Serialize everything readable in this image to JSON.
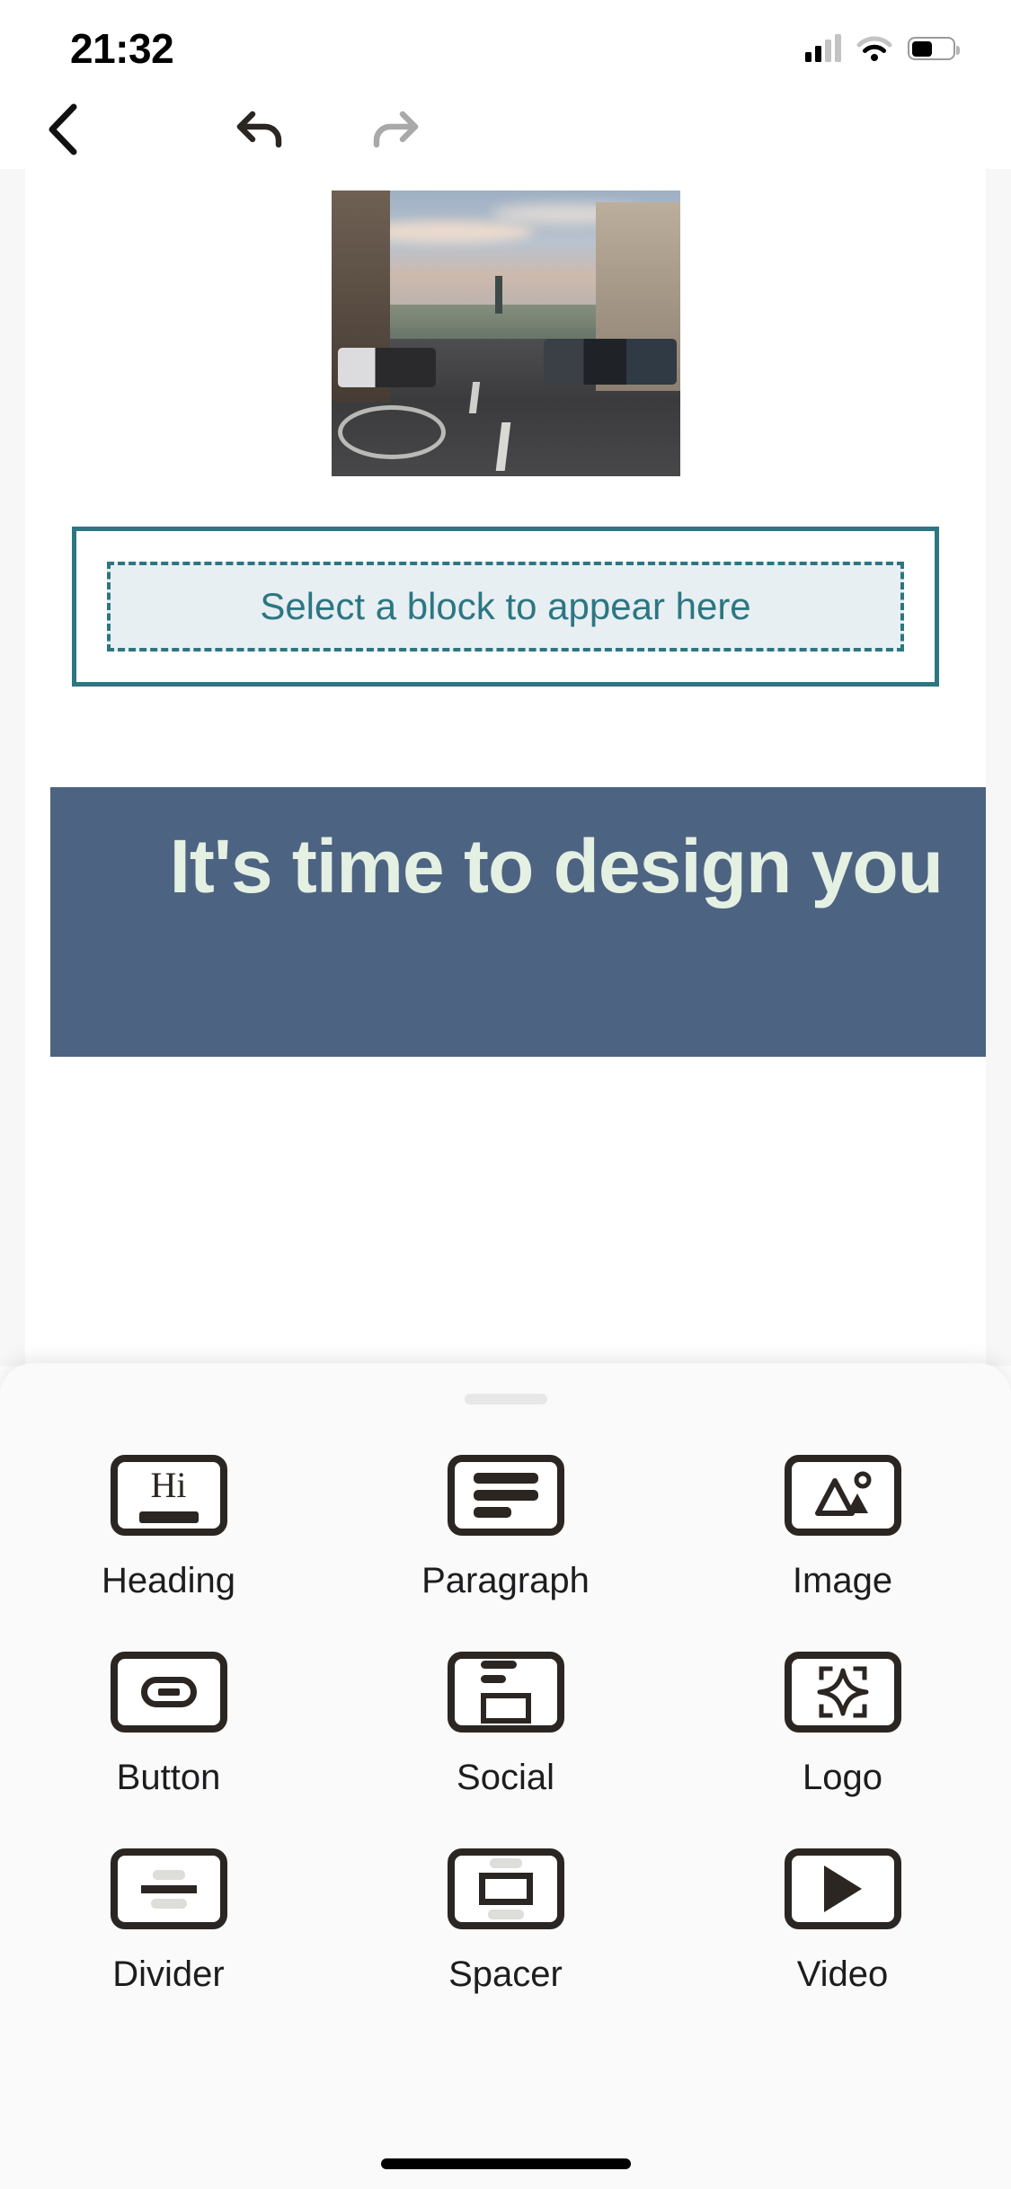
{
  "status_bar": {
    "time": "21:32",
    "cellular_icon": "cellular-signal-icon",
    "wifi_icon": "wifi-icon",
    "battery_icon": "battery-icon",
    "battery_level_percent": 52
  },
  "toolbar": {
    "back_icon": "chevron-left-icon",
    "undo_icon": "undo-arrow-icon",
    "redo_icon": "redo-arrow-icon",
    "undo_enabled": true,
    "redo_enabled": false
  },
  "canvas": {
    "image_block": {
      "alt": "street-photo"
    },
    "drop_zone": {
      "text": "Select a block to appear here",
      "border_color": "#2d7682",
      "fill_color": "#e7eff2",
      "text_color": "#2d7682"
    },
    "hero_block": {
      "title": "It's time to design you",
      "background_color": "#4d6382",
      "text_color": "#e4f0e2"
    }
  },
  "block_picker": {
    "grabber": "drag-handle",
    "blocks": [
      {
        "label": "Heading",
        "icon": "heading-icon"
      },
      {
        "label": "Paragraph",
        "icon": "paragraph-icon"
      },
      {
        "label": "Image",
        "icon": "image-icon"
      },
      {
        "label": "Button",
        "icon": "button-icon"
      },
      {
        "label": "Social",
        "icon": "social-icon"
      },
      {
        "label": "Logo",
        "icon": "logo-icon"
      },
      {
        "label": "Divider",
        "icon": "divider-icon"
      },
      {
        "label": "Spacer",
        "icon": "spacer-icon"
      },
      {
        "label": "Video",
        "icon": "video-icon"
      }
    ]
  }
}
